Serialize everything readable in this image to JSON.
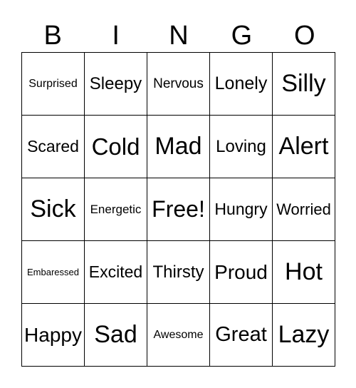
{
  "header": [
    "B",
    "I",
    "N",
    "G",
    "O"
  ],
  "cells": [
    "Surprised",
    "Sleepy",
    "Nervous",
    "Lonely",
    "Silly",
    "Scared",
    "Cold",
    "Mad",
    "Loving",
    "Alert",
    "Sick",
    "Energetic",
    "Free!",
    "Hungry",
    "Worried",
    "Embaressed",
    "Excited",
    "Thirsty",
    "Proud",
    "Hot",
    "Happy",
    "Sad",
    "Awesome",
    "Great",
    "Lazy"
  ]
}
